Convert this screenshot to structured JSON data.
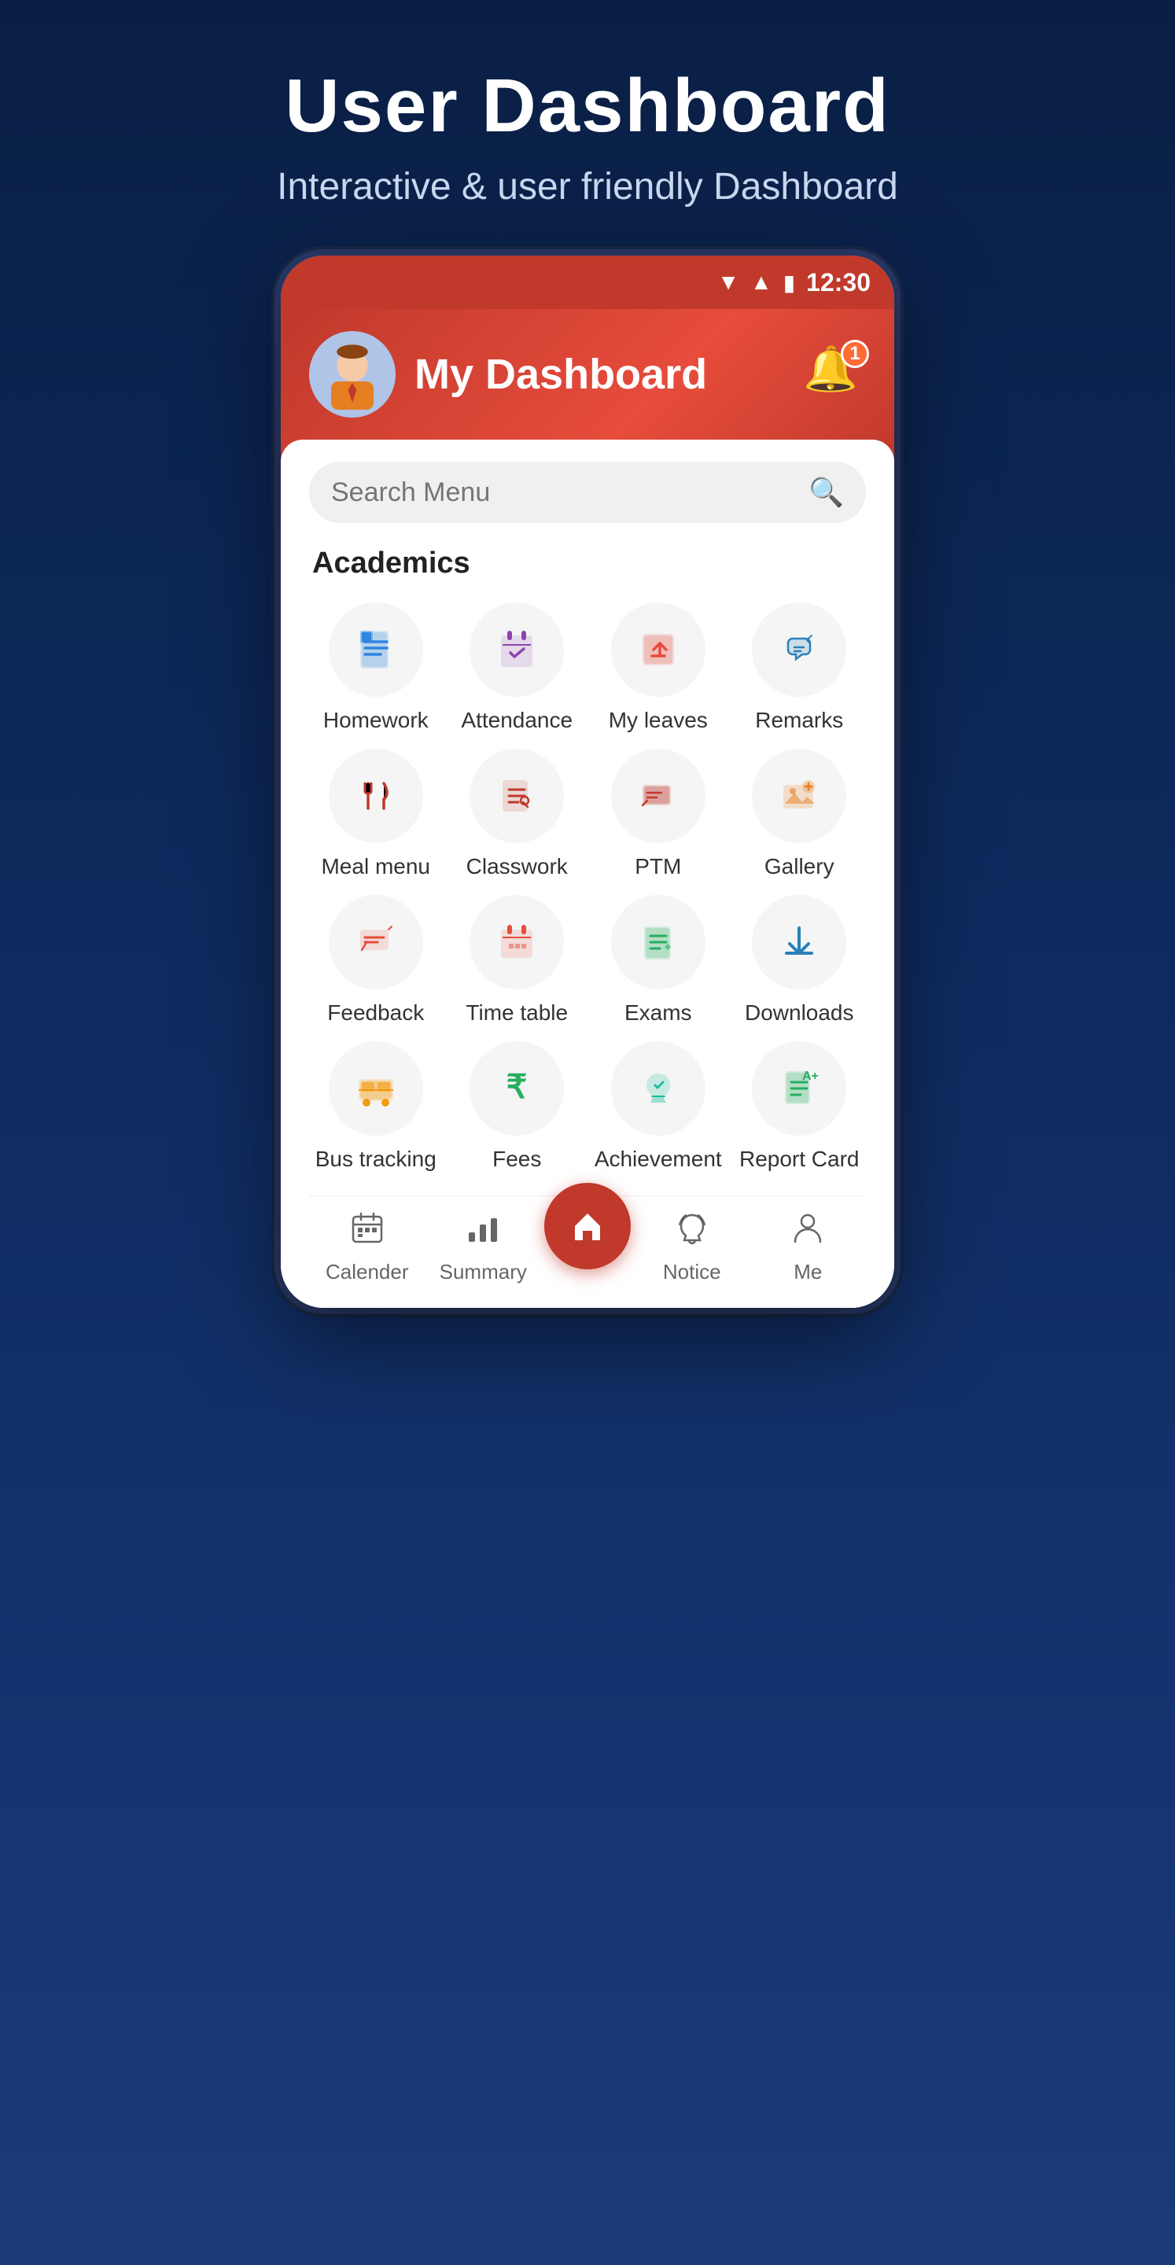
{
  "header": {
    "title": "User Dashboard",
    "subtitle": "Interactive & user friendly Dashboard"
  },
  "statusBar": {
    "time": "12:30"
  },
  "appHeader": {
    "title": "My Dashboard",
    "notificationCount": "1"
  },
  "search": {
    "placeholder": "Search Menu"
  },
  "academicsSection": {
    "label": "Academics"
  },
  "gridItems": [
    {
      "id": "homework",
      "label": "Homework",
      "icon": "📄"
    },
    {
      "id": "attendance",
      "label": "Attendance",
      "icon": "✅"
    },
    {
      "id": "myleaves",
      "label": "My leaves",
      "icon": "📤"
    },
    {
      "id": "remarks",
      "label": "Remarks",
      "icon": "👍"
    },
    {
      "id": "mealmenu",
      "label": "Meal menu",
      "icon": "🍴"
    },
    {
      "id": "classwork",
      "label": "Classwork",
      "icon": "📝"
    },
    {
      "id": "ptm",
      "label": "PTM",
      "icon": "💬"
    },
    {
      "id": "gallery",
      "label": "Gallery",
      "icon": "🎥"
    },
    {
      "id": "feedback",
      "label": "Feedback",
      "icon": "💬"
    },
    {
      "id": "timetable",
      "label": "Time table",
      "icon": "📅"
    },
    {
      "id": "exams",
      "label": "Exams",
      "icon": "📋"
    },
    {
      "id": "downloads",
      "label": "Downloads",
      "icon": "⬇️"
    },
    {
      "id": "bustracking",
      "label": "Bus tracking",
      "icon": "🚌"
    },
    {
      "id": "fees",
      "label": "Fees",
      "icon": "₹"
    },
    {
      "id": "achievement",
      "label": "Achievement",
      "icon": "🏅"
    },
    {
      "id": "reportcard",
      "label": "Report Card",
      "icon": "📄"
    }
  ],
  "bottomNav": {
    "items": [
      {
        "id": "calender",
        "label": "Calender",
        "icon": "📅"
      },
      {
        "id": "summary",
        "label": "Summary",
        "icon": "📊"
      },
      {
        "id": "home",
        "label": "",
        "icon": "🏠"
      },
      {
        "id": "notice",
        "label": "Notice",
        "icon": "🔊"
      },
      {
        "id": "me",
        "label": "Me",
        "icon": "👤"
      }
    ]
  }
}
